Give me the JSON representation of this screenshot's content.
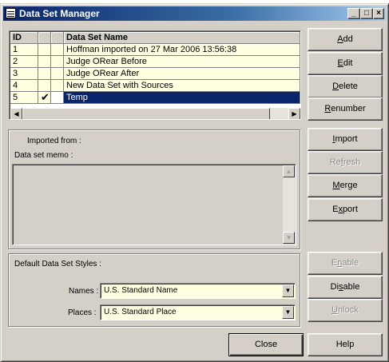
{
  "window": {
    "title": "Data Set Manager"
  },
  "caption_buttons": {
    "minimize": "_",
    "maximize": "□",
    "close": "×"
  },
  "grid": {
    "headers": {
      "id": "ID",
      "col2": "",
      "col3": "",
      "name": "Data Set Name"
    },
    "rows": [
      {
        "id": "1",
        "check": "",
        "name": "Hoffman imported on 27 Mar 2006 13:56:38"
      },
      {
        "id": "2",
        "check": "",
        "name": "Judge ORear Before"
      },
      {
        "id": "3",
        "check": "",
        "name": "Judge ORear After"
      },
      {
        "id": "4",
        "check": "",
        "name": "New Data Set with Sources"
      },
      {
        "id": "5",
        "check": "✔",
        "name": "Temp"
      }
    ],
    "selected_row": 5
  },
  "details": {
    "imported_from_label": "Imported from :",
    "memo_label": "Data set memo :",
    "memo_value": ""
  },
  "styles": {
    "heading": "Default Data Set Styles :",
    "names_label": "Names :",
    "names_value": "U.S. Standard Name",
    "places_label": "Places :",
    "places_value": "U.S. Standard Place"
  },
  "buttons": {
    "add": {
      "mnemonic": "A",
      "rest": "dd"
    },
    "edit": {
      "mnemonic": "E",
      "rest": "dit"
    },
    "delete": {
      "mnemonic": "D",
      "rest": "elete"
    },
    "renumber": {
      "mnemonic": "R",
      "rest": "enumber"
    },
    "import": {
      "mnemonic": "I",
      "rest": "mport"
    },
    "refresh": {
      "pre": "Re",
      "mnemonic": "f",
      "rest": "resh"
    },
    "merge": {
      "pre": "",
      "mnemonic": "M",
      "rest": "erge"
    },
    "export": {
      "pre": "E",
      "mnemonic": "x",
      "rest": "port"
    },
    "enable": {
      "pre": "E",
      "mnemonic": "n",
      "rest": "able"
    },
    "disable": {
      "pre": "Di",
      "mnemonic": "s",
      "rest": "able"
    },
    "unlock": {
      "pre": "",
      "mnemonic": "U",
      "rest": "nlock"
    },
    "close": "Close",
    "help": "Help"
  }
}
